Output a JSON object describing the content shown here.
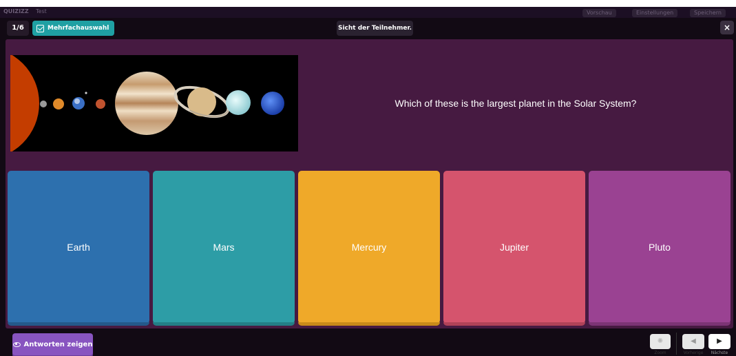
{
  "underlying": {
    "app_logo": "QUIZIZZ",
    "doc_title": "Test",
    "buttons": [
      "Vorschau",
      "Einstellungen",
      "Speichern"
    ]
  },
  "header": {
    "counter": "1/6",
    "question_type": "Mehrfachauswahl",
    "visibility": "Sicht der Teilnehmer.",
    "close_label": "×"
  },
  "question": {
    "text": "Which of these is the largest planet in the Solar System?",
    "image_icon": "solar-system-image"
  },
  "answers": [
    {
      "label": "Earth",
      "color": "#2d70ae"
    },
    {
      "label": "Mars",
      "color": "#2d9da6"
    },
    {
      "label": "Mercury",
      "color": "#efa929"
    },
    {
      "label": "Jupiter",
      "color": "#d5546d"
    },
    {
      "label": "Pluto",
      "color": "#9a4292"
    }
  ],
  "footer": {
    "show_answers": "Antworten zeigen",
    "zoom_label": "Zoom",
    "prev_label": "Vorherige",
    "next_label": "Nächste",
    "prev_glyph": "◀",
    "next_glyph": "▶",
    "zoom_glyph": "✺"
  },
  "colors": {
    "stage": "#461a41",
    "accent_teal": "#1fa0a3",
    "accent_purple": "#8854c0"
  }
}
